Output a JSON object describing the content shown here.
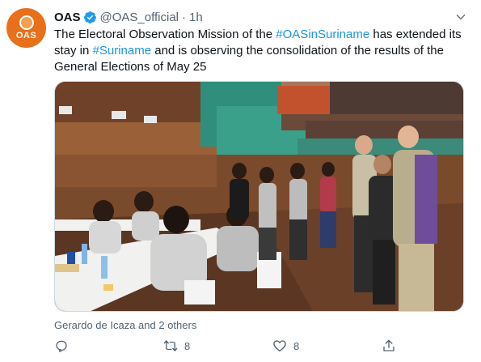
{
  "account": {
    "name": "OAS",
    "handle": "@OAS_official",
    "separator": "·",
    "time": "1h",
    "avatar_text": "OAS"
  },
  "tweet": {
    "text_before_1": "The Electoral Observation Mission of the ",
    "hashtag_1": "#OASinSuriname",
    "text_before_2": " has extended its stay in ",
    "hashtag_2": "#Suriname",
    "text_after": " and is observing the consolidation of the results of the General Elections of May 25"
  },
  "liked_by": "Gerardo de Icaza and 2 others",
  "actions": {
    "reply_count": "",
    "retweet_count": "8",
    "like_count": "8",
    "share_count": ""
  },
  "colors": {
    "link": "#1b95e0",
    "secondary": "#536471",
    "avatar_bg": "#e8701a"
  },
  "icons": [
    "verified-badge-icon",
    "chevron-down-icon",
    "reply-icon",
    "retweet-icon",
    "like-icon",
    "share-icon"
  ]
}
